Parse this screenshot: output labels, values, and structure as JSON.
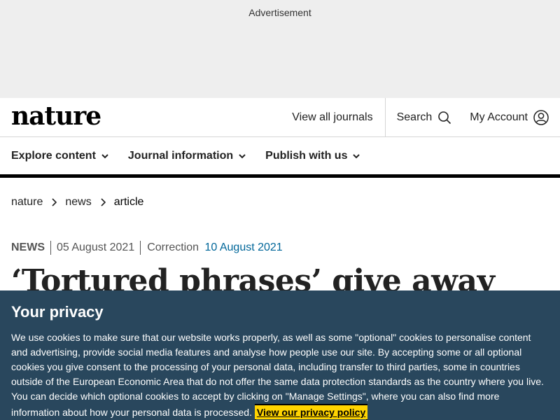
{
  "ad": {
    "label": "Advertisement"
  },
  "header": {
    "logo": "nature",
    "view_all_journals": "View all journals",
    "search_label": "Search",
    "account_label": "My Account"
  },
  "nav": {
    "items": [
      {
        "label": "Explore content"
      },
      {
        "label": "Journal information"
      },
      {
        "label": "Publish with us"
      }
    ]
  },
  "breadcrumb": {
    "items": [
      "nature",
      "news",
      "article"
    ]
  },
  "article": {
    "type": "NEWS",
    "date": "05 August 2021",
    "correction_label": "Correction",
    "correction_date": "10 August 2021",
    "title": "‘Tortured phrases’ give away"
  },
  "privacy": {
    "title": "Your privacy",
    "body": "We use cookies to make sure that our website works properly, as well as some \"optional\" cookies to personalise content and advertising, provide social media features and analyse how people use our site. By accepting some or all optional cookies you give consent to the processing of your personal data, including transfer to third parties, some in countries outside of the European Economic Area that do not offer the same data protection standards as the country where you live. You can decide which optional cookies to accept by clicking on \"Manage Settings\", where you can also find more information about how your personal data is processed.",
    "link": "View our privacy policy"
  },
  "colors": {
    "privacy_bg": "#29475d",
    "link_highlight": "#ffd400",
    "correction_link": "#006699"
  }
}
